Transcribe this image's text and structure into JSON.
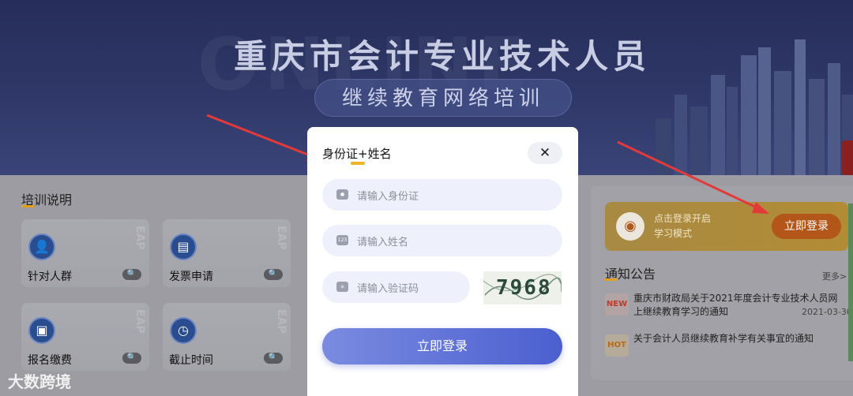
{
  "banner": {
    "title": "重庆市会计专业技术人员",
    "subtitle": "继续教育网络培训"
  },
  "training": {
    "section_title": "培训说明",
    "cards": [
      {
        "label": "针对人群",
        "icon": "people-icon"
      },
      {
        "label": "发票申请",
        "icon": "invoice-icon"
      },
      {
        "label": "报名缴费",
        "icon": "wallet-icon"
      },
      {
        "label": "截止时间",
        "icon": "clock-icon"
      }
    ]
  },
  "promo": {
    "text_line1": "点击登录开启",
    "text_line2": "学习模式",
    "button": "立即登录"
  },
  "notice": {
    "title": "通知公告",
    "more": "更多>",
    "items": [
      {
        "tag": "NEW",
        "text_line1": "重庆市财政局关于2021年度会计专业技术人员网",
        "text_line2": "上继续教育学习的通知",
        "date": "2021-03-30"
      },
      {
        "tag": "HOT",
        "text_line1": "关于会计人员继续教育补学有关事宜的通知"
      }
    ]
  },
  "modal": {
    "tab_label": "身份证+姓名",
    "close": "✕",
    "id_placeholder": "请输入身份证",
    "name_placeholder": "请输入姓名",
    "captcha_placeholder": "请输入验证码",
    "captcha_code": "7968",
    "login_button": "立即登录"
  },
  "watermark": "大数跨境",
  "colors": {
    "accent": "#f0b429",
    "login_gradient_start": "#7a8be0",
    "login_gradient_end": "#4b5fd0",
    "banner": "#2f3868"
  }
}
